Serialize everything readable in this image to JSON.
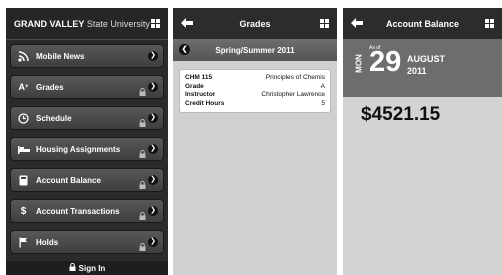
{
  "screen1": {
    "brand_bold": "GRAND VALLEY",
    "brand_light": "State University",
    "menu": [
      {
        "label": "Mobile News",
        "icon": "rss-icon",
        "locked": false
      },
      {
        "label": "Grades",
        "icon": "grade-icon",
        "locked": true
      },
      {
        "label": "Schedule",
        "icon": "clock-icon",
        "locked": true
      },
      {
        "label": "Housing Assignments",
        "icon": "bed-icon",
        "locked": true
      },
      {
        "label": "Account Balance",
        "icon": "calculator-icon",
        "locked": true
      },
      {
        "label": "Account Transactions",
        "icon": "dollar-icon",
        "locked": true
      },
      {
        "label": "Holds",
        "icon": "flag-icon",
        "locked": true
      }
    ],
    "signin": "Sign In"
  },
  "screen2": {
    "title": "Grades",
    "term": "Spring/Summer 2011",
    "rows": [
      {
        "key": "CHM 115",
        "value": "Principles of Chemis"
      },
      {
        "key": "Grade",
        "value": "A"
      },
      {
        "key": "Instructor",
        "value": "Christopher Lawrence"
      },
      {
        "key": "Credit Hours",
        "value": "5"
      }
    ]
  },
  "screen3": {
    "title": "Account Balance",
    "as_of": "As of",
    "weekday": "MON",
    "day": "29",
    "month": "AUGUST",
    "year": "2011",
    "balance": "$4521.15"
  },
  "colors": {
    "accent_dark": "#2b2b2b",
    "panel": "#d3d3d3"
  }
}
